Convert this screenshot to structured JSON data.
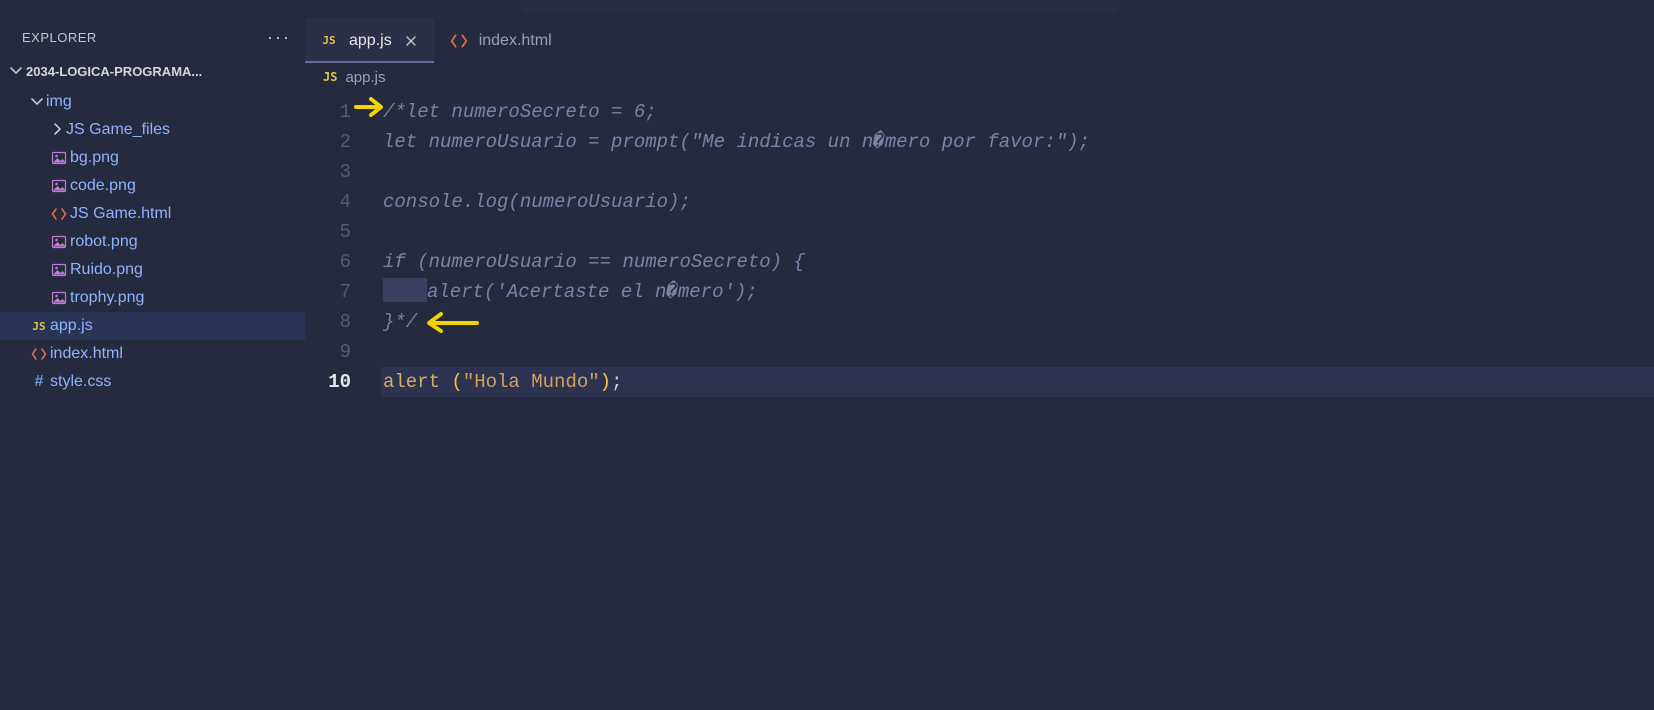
{
  "explorer": {
    "title": "EXPLORER",
    "project": "2034-LOGICA-PROGRAMA...",
    "tree": {
      "folders": {
        "img": {
          "label": "img"
        },
        "gamefiles": {
          "label": "JS Game_files"
        }
      },
      "files": {
        "bg": {
          "label": "bg.png"
        },
        "code": {
          "label": "code.png"
        },
        "gamehtml": {
          "label": "JS Game.html"
        },
        "robot": {
          "label": "robot.png"
        },
        "ruido": {
          "label": "Ruido.png"
        },
        "trophy": {
          "label": "trophy.png"
        },
        "appjs": {
          "label": "app.js"
        },
        "indexhtml": {
          "label": "index.html"
        },
        "stylecss": {
          "label": "style.css"
        }
      }
    }
  },
  "tabs": {
    "appjs": {
      "label": "app.js"
    },
    "indexhtml": {
      "label": "index.html"
    }
  },
  "breadcrumb": {
    "file": "app.js"
  },
  "editor": {
    "lines": {
      "l1": "/*let numeroSecreto = 6;",
      "l2": "let numeroUsuario = prompt(\"Me indicas un n�mero por favor:\");",
      "l3": "",
      "l4": "console.log(numeroUsuario);",
      "l5": "",
      "l6": "if (numeroUsuario == numeroSecreto) {",
      "l7_tail": "alert('Acertaste el n�mero');",
      "l8": "}*/",
      "l9": "",
      "l10_fn": "alert",
      "l10_sp": " ",
      "l10_op": "(",
      "l10_str": "\"Hola Mundo\"",
      "l10_cp": ")",
      "l10_semi": ";"
    },
    "line_numbers": [
      "1",
      "2",
      "3",
      "4",
      "5",
      "6",
      "7",
      "8",
      "9",
      "10"
    ]
  },
  "iconLabels": {
    "js": "JS",
    "hash": "#"
  }
}
